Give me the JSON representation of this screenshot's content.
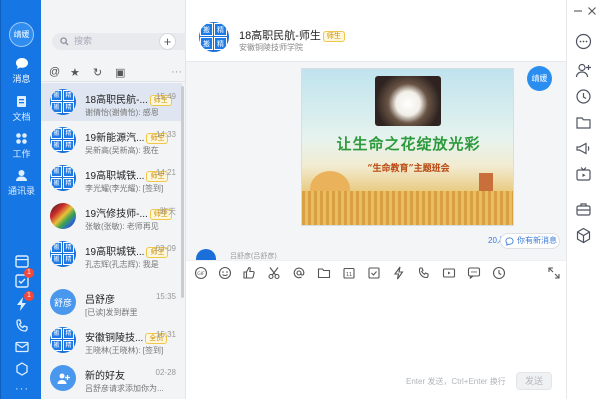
{
  "me": {
    "avatar_text": "靖媛"
  },
  "nav": {
    "items": [
      {
        "label": "消息",
        "icon": "chat-icon"
      },
      {
        "label": "文档",
        "icon": "document-icon"
      },
      {
        "label": "工作",
        "icon": "apps-icon"
      },
      {
        "label": "通讯录",
        "icon": "contacts-icon"
      }
    ],
    "badges": [
      "1",
      "1"
    ]
  },
  "list": {
    "search_placeholder": "搜索",
    "add_label": "+",
    "more_label": "···",
    "items": [
      {
        "name": "18高职民航-...",
        "tag": "师生",
        "time": "15:49",
        "preview": "谢倩怡(谢倩怡): 感恩",
        "avatar": "group"
      },
      {
        "name": "19新能源汽...",
        "tag": "师生",
        "time": "14:33",
        "preview": "吴新高(吴新高): 我在",
        "avatar": "group"
      },
      {
        "name": "19高职城铁...",
        "tag": "师生",
        "time": "14:21",
        "preview": "李光耀(李光耀): [签到]",
        "avatar": "group"
      },
      {
        "name": "19汽修技师-...",
        "tag": "师生",
        "time": "昨天",
        "preview": "张敏(张敏): 老师再见",
        "avatar": "image"
      },
      {
        "name": "19高职城铁...",
        "tag": "师生",
        "time": "03-09",
        "preview": "孔志辉(孔志辉): 我是",
        "avatar": "group"
      },
      {
        "name": "吕舒彦",
        "tag": "",
        "time": "15:35",
        "preview": "[已读]发到群里",
        "avatar": "text",
        "avatar_text": "舒彦"
      },
      {
        "name": "安徽铜陵技...",
        "tag": "全员",
        "time": "15:31",
        "preview": "王晓林(王晓林): [签到]",
        "avatar": "group"
      },
      {
        "name": "新的好友",
        "tag": "",
        "time": "02-28",
        "preview": "吕舒彦请求添加你为...",
        "avatar": "plus"
      }
    ]
  },
  "chat": {
    "title": "18高职民航-师生",
    "tag": "师生",
    "subtitle": "安徽铜陵技师学院",
    "image_title": "让生命之花绽放光彩",
    "image_subtitle": "“生命教育”主题班会",
    "self_avatar": "靖媛",
    "time_mark": "20人",
    "new_message_label": "你有新消息",
    "sender_name": "吕舒彦(吕舒彦)",
    "input_hint": "Enter 发送，Ctrl+Enter 换行",
    "send_label": "发送"
  },
  "avatar_grid": [
    "搬",
    "精",
    "搬",
    "精"
  ]
}
